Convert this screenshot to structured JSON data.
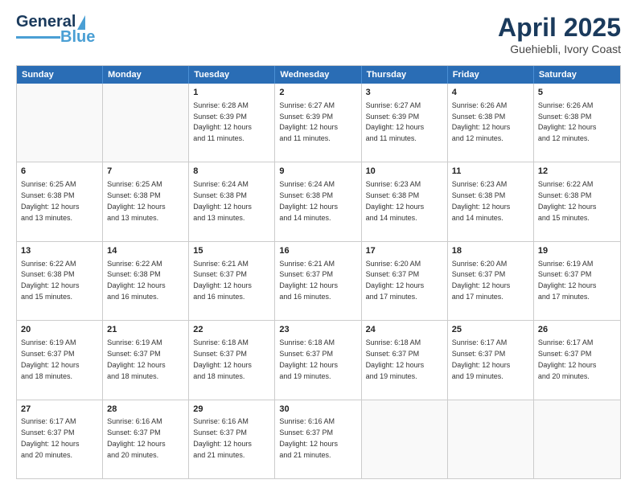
{
  "header": {
    "logo_main": "General",
    "logo_accent": "Blue",
    "title": "April 2025",
    "location": "Guehiebli, Ivory Coast"
  },
  "calendar": {
    "days": [
      "Sunday",
      "Monday",
      "Tuesday",
      "Wednesday",
      "Thursday",
      "Friday",
      "Saturday"
    ],
    "rows": [
      [
        {
          "day": "",
          "info": ""
        },
        {
          "day": "",
          "info": ""
        },
        {
          "day": "1",
          "info": "Sunrise: 6:28 AM\nSunset: 6:39 PM\nDaylight: 12 hours\nand 11 minutes."
        },
        {
          "day": "2",
          "info": "Sunrise: 6:27 AM\nSunset: 6:39 PM\nDaylight: 12 hours\nand 11 minutes."
        },
        {
          "day": "3",
          "info": "Sunrise: 6:27 AM\nSunset: 6:39 PM\nDaylight: 12 hours\nand 11 minutes."
        },
        {
          "day": "4",
          "info": "Sunrise: 6:26 AM\nSunset: 6:38 PM\nDaylight: 12 hours\nand 12 minutes."
        },
        {
          "day": "5",
          "info": "Sunrise: 6:26 AM\nSunset: 6:38 PM\nDaylight: 12 hours\nand 12 minutes."
        }
      ],
      [
        {
          "day": "6",
          "info": "Sunrise: 6:25 AM\nSunset: 6:38 PM\nDaylight: 12 hours\nand 13 minutes."
        },
        {
          "day": "7",
          "info": "Sunrise: 6:25 AM\nSunset: 6:38 PM\nDaylight: 12 hours\nand 13 minutes."
        },
        {
          "day": "8",
          "info": "Sunrise: 6:24 AM\nSunset: 6:38 PM\nDaylight: 12 hours\nand 13 minutes."
        },
        {
          "day": "9",
          "info": "Sunrise: 6:24 AM\nSunset: 6:38 PM\nDaylight: 12 hours\nand 14 minutes."
        },
        {
          "day": "10",
          "info": "Sunrise: 6:23 AM\nSunset: 6:38 PM\nDaylight: 12 hours\nand 14 minutes."
        },
        {
          "day": "11",
          "info": "Sunrise: 6:23 AM\nSunset: 6:38 PM\nDaylight: 12 hours\nand 14 minutes."
        },
        {
          "day": "12",
          "info": "Sunrise: 6:22 AM\nSunset: 6:38 PM\nDaylight: 12 hours\nand 15 minutes."
        }
      ],
      [
        {
          "day": "13",
          "info": "Sunrise: 6:22 AM\nSunset: 6:38 PM\nDaylight: 12 hours\nand 15 minutes."
        },
        {
          "day": "14",
          "info": "Sunrise: 6:22 AM\nSunset: 6:38 PM\nDaylight: 12 hours\nand 16 minutes."
        },
        {
          "day": "15",
          "info": "Sunrise: 6:21 AM\nSunset: 6:37 PM\nDaylight: 12 hours\nand 16 minutes."
        },
        {
          "day": "16",
          "info": "Sunrise: 6:21 AM\nSunset: 6:37 PM\nDaylight: 12 hours\nand 16 minutes."
        },
        {
          "day": "17",
          "info": "Sunrise: 6:20 AM\nSunset: 6:37 PM\nDaylight: 12 hours\nand 17 minutes."
        },
        {
          "day": "18",
          "info": "Sunrise: 6:20 AM\nSunset: 6:37 PM\nDaylight: 12 hours\nand 17 minutes."
        },
        {
          "day": "19",
          "info": "Sunrise: 6:19 AM\nSunset: 6:37 PM\nDaylight: 12 hours\nand 17 minutes."
        }
      ],
      [
        {
          "day": "20",
          "info": "Sunrise: 6:19 AM\nSunset: 6:37 PM\nDaylight: 12 hours\nand 18 minutes."
        },
        {
          "day": "21",
          "info": "Sunrise: 6:19 AM\nSunset: 6:37 PM\nDaylight: 12 hours\nand 18 minutes."
        },
        {
          "day": "22",
          "info": "Sunrise: 6:18 AM\nSunset: 6:37 PM\nDaylight: 12 hours\nand 18 minutes."
        },
        {
          "day": "23",
          "info": "Sunrise: 6:18 AM\nSunset: 6:37 PM\nDaylight: 12 hours\nand 19 minutes."
        },
        {
          "day": "24",
          "info": "Sunrise: 6:18 AM\nSunset: 6:37 PM\nDaylight: 12 hours\nand 19 minutes."
        },
        {
          "day": "25",
          "info": "Sunrise: 6:17 AM\nSunset: 6:37 PM\nDaylight: 12 hours\nand 19 minutes."
        },
        {
          "day": "26",
          "info": "Sunrise: 6:17 AM\nSunset: 6:37 PM\nDaylight: 12 hours\nand 20 minutes."
        }
      ],
      [
        {
          "day": "27",
          "info": "Sunrise: 6:17 AM\nSunset: 6:37 PM\nDaylight: 12 hours\nand 20 minutes."
        },
        {
          "day": "28",
          "info": "Sunrise: 6:16 AM\nSunset: 6:37 PM\nDaylight: 12 hours\nand 20 minutes."
        },
        {
          "day": "29",
          "info": "Sunrise: 6:16 AM\nSunset: 6:37 PM\nDaylight: 12 hours\nand 21 minutes."
        },
        {
          "day": "30",
          "info": "Sunrise: 6:16 AM\nSunset: 6:37 PM\nDaylight: 12 hours\nand 21 minutes."
        },
        {
          "day": "",
          "info": ""
        },
        {
          "day": "",
          "info": ""
        },
        {
          "day": "",
          "info": ""
        }
      ]
    ]
  }
}
